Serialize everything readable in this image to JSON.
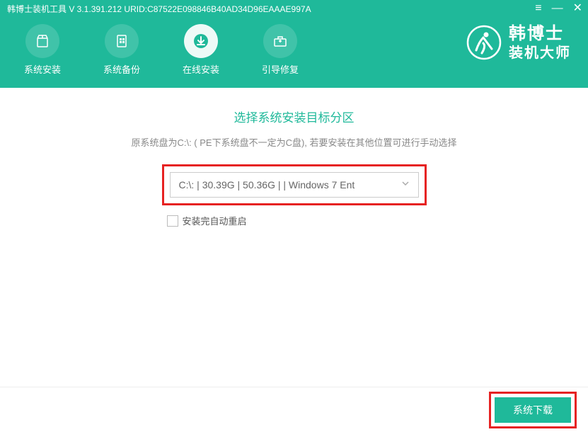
{
  "app": {
    "title": "韩博士装机工具 V 3.1.391.212 URID:C87522E098846B40AD34D96EAAAE997A"
  },
  "nav": {
    "items": [
      {
        "label": "系统安装"
      },
      {
        "label": "系统备份"
      },
      {
        "label": "在线安装"
      },
      {
        "label": "引导修复"
      }
    ]
  },
  "logo": {
    "line1": "韩博士",
    "line2": "装机大师"
  },
  "main": {
    "section_title": "选择系统安装目标分区",
    "hint": "原系统盘为C:\\: ( PE下系统盘不一定为C盘), 若要安装在其他位置可进行手动选择",
    "partition_selected": "C:\\: | 30.39G | 50.36G |  | Windows 7 Ent",
    "auto_restart_label": "安装完自动重启"
  },
  "footer": {
    "download_label": "系统下载"
  }
}
